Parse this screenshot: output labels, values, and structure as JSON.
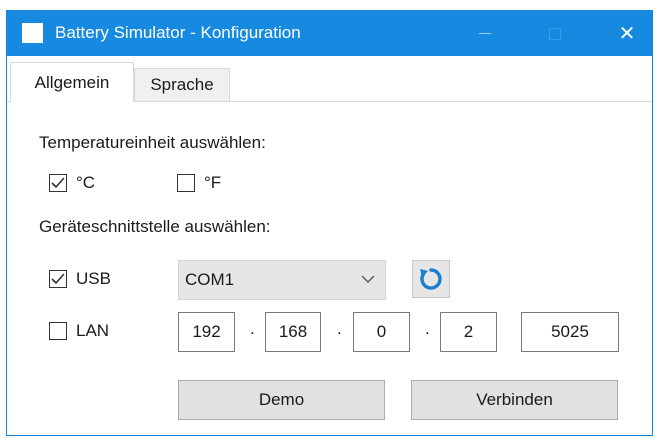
{
  "window": {
    "title": "Battery Simulator - Konfiguration",
    "minimize_icon": "minimize-icon",
    "maximize_icon": "maximize-icon",
    "close_glyph": "✕"
  },
  "tabs": [
    {
      "label": "Allgemein",
      "active": true
    },
    {
      "label": "Sprache",
      "active": false
    }
  ],
  "temperature": {
    "heading": "Temperatureinheit auswählen:",
    "options": [
      {
        "label": "°C",
        "checked": true
      },
      {
        "label": "°F",
        "checked": false
      }
    ]
  },
  "interface": {
    "heading": "Geräteschnittstelle auswählen:",
    "usb": {
      "label": "USB",
      "checked": true,
      "port": "COM1",
      "refresh_icon": "refresh-icon"
    },
    "lan": {
      "label": "LAN",
      "checked": false,
      "ip": [
        "192",
        "168",
        "0",
        "2"
      ],
      "separator": ".",
      "port": "5025"
    }
  },
  "buttons": {
    "demo": "Demo",
    "connect": "Verbinden"
  },
  "colors": {
    "titlebar": "#1689e1",
    "accent": "#1a7fd0"
  }
}
